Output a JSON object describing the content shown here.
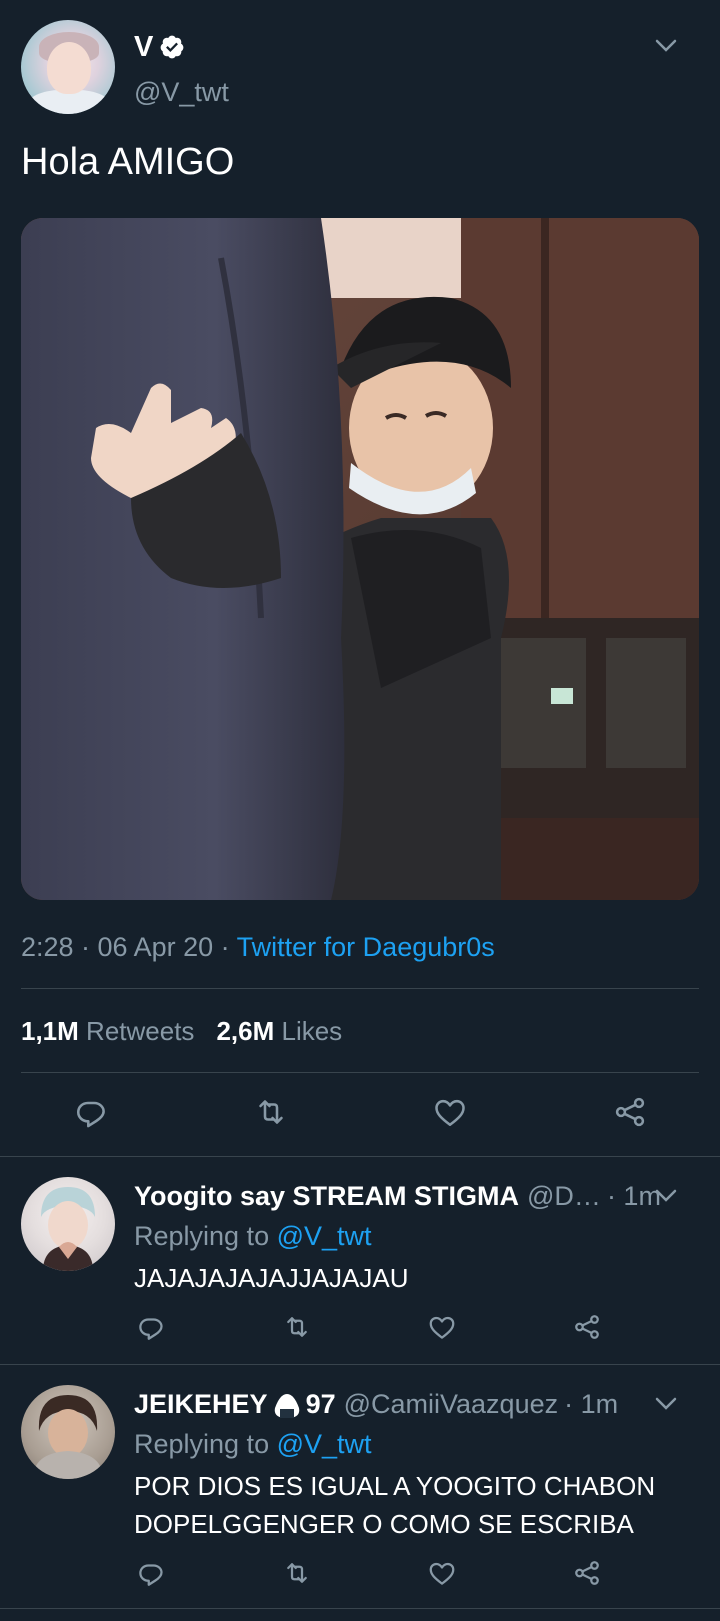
{
  "tweet": {
    "display_name": "V",
    "handle": "@V_twt",
    "text": "Hola AMIGO",
    "time": "2:28 · 06 Apr 20 · ",
    "source": "Twitter for Daegubr0s",
    "retweets_count": "1,1M",
    "retweets_label": "Retweets",
    "likes_count": "2,6M",
    "likes_label": "Likes"
  },
  "replies": [
    {
      "name": "Yoogito say STREAM STIGMA",
      "handle": "@D…",
      "time": "· 1m",
      "replying_label": "Replying to ",
      "replying_to": "@V_twt",
      "text": "JAJAJAJAJAJJAJAJAU"
    },
    {
      "name": "JEIKEHEY",
      "name_suffix": "97",
      "handle": "@CamiiVaazquez",
      "time": "· 1m",
      "replying_label": "Replying to ",
      "replying_to": "@V_twt",
      "text_line1": "POR DIOS ES IGUAL A YOOGITO CHABON",
      "text_line2": "DOPELGGENGER O COMO SE ESCRIBA"
    }
  ],
  "icons": [
    "verified-icon",
    "chevron-down-icon",
    "reply-icon",
    "retweet-icon",
    "like-icon",
    "share-icon",
    "onigiri-emoji"
  ],
  "colors": {
    "background": "#15202b",
    "accent": "#1da1f2",
    "secondary_text": "#8899a6",
    "divider": "#38444d"
  }
}
